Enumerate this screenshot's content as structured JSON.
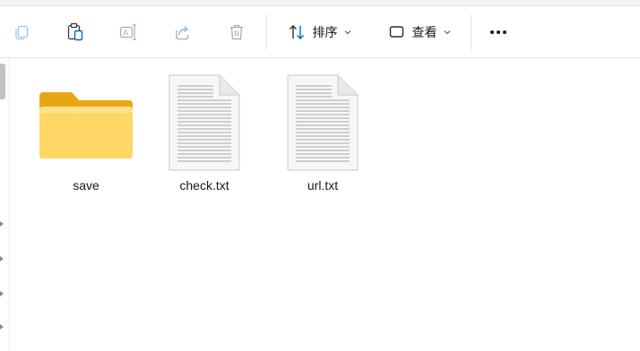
{
  "toolbar": {
    "copy_icon": "copy-icon",
    "paste_icon": "paste-icon",
    "rename_icon": "rename-icon",
    "share_icon": "share-icon",
    "delete_icon": "delete-icon",
    "sort_label": "排序",
    "view_label": "查看",
    "more_icon": "more-icon"
  },
  "files": [
    {
      "name": "save",
      "type": "folder"
    },
    {
      "name": "check.txt",
      "type": "text-file"
    },
    {
      "name": "url.txt",
      "type": "text-file"
    }
  ],
  "colors": {
    "folder_back": "#E8A712",
    "folder_front": "#FFD766",
    "accent": "#0067C0"
  }
}
